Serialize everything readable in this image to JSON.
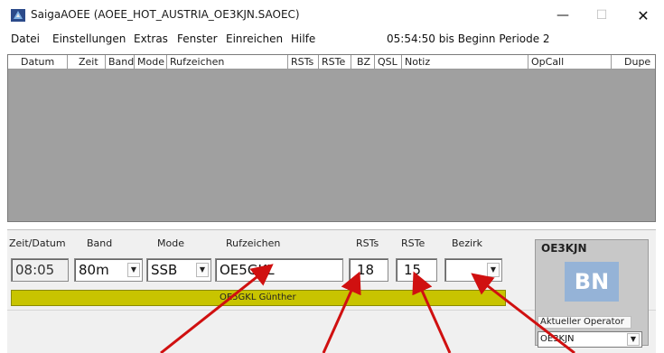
{
  "window": {
    "title": "SaigaAOEE (AOEE_HOT_AUSTRIA_OE3KJN.SAOEC)",
    "minimize": "—",
    "maximize": "☐",
    "close": "✕"
  },
  "menu": {
    "items": [
      "Datei",
      "Einstellungen",
      "Extras",
      "Fenster",
      "Einreichen",
      "Hilfe"
    ],
    "countdown": "05:54:50 bis Beginn Periode 2"
  },
  "log": {
    "columns": [
      "Datum",
      "Zeit",
      "Band",
      "Mode",
      "Rufzeichen",
      "RSTs",
      "RSTe",
      "BZ",
      "QSL",
      "Notiz",
      "OpCall",
      "Dupe"
    ]
  },
  "entry": {
    "headers": {
      "time": "Zeit/Datum",
      "band": "Band",
      "mode": "Mode",
      "call": "Rufzeichen",
      "rsts": "RSTs",
      "rste": "RSTe",
      "district": "Bezirk"
    },
    "values": {
      "time": "08:05",
      "band": "80m",
      "mode": "SSB",
      "call": "OE5GKL",
      "rsts": "18",
      "rste": "15",
      "district": ""
    },
    "info": "OE5GKL Günther"
  },
  "operator": {
    "callsign": "OE3KJN",
    "badge": "BN",
    "label": "Aktueller Operator",
    "selected": "OE3KJN"
  },
  "colors": {
    "info_bar": "#c8c400",
    "badge": "#95b3d7",
    "arrow": "#d01010",
    "log_bg": "#a0a0a0"
  }
}
